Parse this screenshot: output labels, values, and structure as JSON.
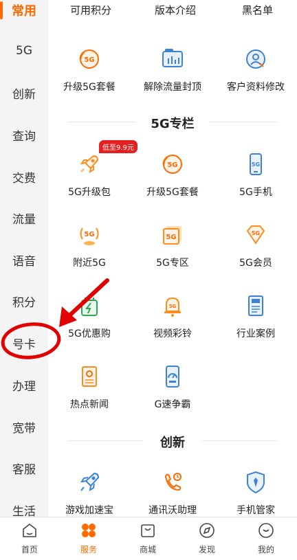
{
  "sidebar": {
    "items": [
      {
        "label": "常用",
        "active": true
      },
      {
        "label": "5G"
      },
      {
        "label": "创新"
      },
      {
        "label": "查询"
      },
      {
        "label": "交费"
      },
      {
        "label": "流量"
      },
      {
        "label": "语音"
      },
      {
        "label": "积分"
      },
      {
        "label": "号卡"
      },
      {
        "label": "办理"
      },
      {
        "label": "宽带"
      },
      {
        "label": "客服"
      },
      {
        "label": "生活"
      }
    ]
  },
  "topbar": {
    "items": [
      "可用积分",
      "版本介绍",
      "黑名单"
    ]
  },
  "common": {
    "items": [
      {
        "label": "升级5G套餐",
        "icon": "5g-upgrade-icon"
      },
      {
        "label": "解除流量封顶",
        "icon": "traffic-unlock-icon"
      },
      {
        "label": "客户资料修改",
        "icon": "user-profile-icon"
      }
    ]
  },
  "section_5g": {
    "title": "5G专栏",
    "badge": "低至9.9元",
    "items": [
      {
        "label": "5G升级包",
        "icon": "rocket-icon"
      },
      {
        "label": "升级5G套餐",
        "icon": "5g-upgrade-icon"
      },
      {
        "label": "5G手机",
        "icon": "phone-icon"
      },
      {
        "label": "附近5G",
        "icon": "signal-5g-icon"
      },
      {
        "label": "5G专区",
        "icon": "5g-zone-icon"
      },
      {
        "label": "5G会员",
        "icon": "diamond-icon"
      },
      {
        "label": "5G优惠购",
        "icon": "shopping-bag-icon"
      },
      {
        "label": "视频彩铃",
        "icon": "bell-icon"
      },
      {
        "label": "行业案例",
        "icon": "book-icon"
      },
      {
        "label": "热点新闻",
        "icon": "news-icon"
      },
      {
        "label": "G速争霸",
        "icon": "speed-test-icon"
      }
    ]
  },
  "section_innovation": {
    "title": "创新",
    "items": [
      {
        "label": "游戏加速宝",
        "icon": "game-rocket-icon"
      },
      {
        "label": "通讯沃助理",
        "icon": "phone-assistant-icon"
      },
      {
        "label": "手机管家",
        "icon": "shield-icon"
      }
    ]
  },
  "bottom_nav": {
    "items": [
      {
        "label": "首页",
        "icon": "home-icon"
      },
      {
        "label": "服务",
        "icon": "service-icon",
        "active": true
      },
      {
        "label": "商城",
        "icon": "shop-icon"
      },
      {
        "label": "发现",
        "icon": "compass-icon"
      },
      {
        "label": "我的",
        "icon": "profile-icon"
      }
    ]
  },
  "colors": {
    "accent": "#ff6a00",
    "badge": "#e32121",
    "icon_blue": "#3b82d6",
    "annotation_red": "#e00000"
  }
}
